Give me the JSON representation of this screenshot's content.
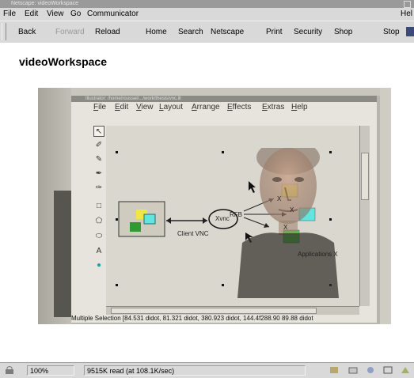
{
  "window": {
    "title": "Netscape: videoWorkspace"
  },
  "menu": [
    "File",
    "Edit",
    "View",
    "Go",
    "Communicator",
    "Hel"
  ],
  "toolbar": {
    "back": "Back",
    "forward": "Forward",
    "reload": "Reload",
    "home": "Home",
    "search": "Search",
    "netscape": "Netscape",
    "print": "Print",
    "security": "Security",
    "shop": "Shop",
    "stop": "Stop"
  },
  "page": {
    "heading": "videoWorkspace"
  },
  "illustrator": {
    "title": "Illustrator: /home/roussel/.../work/thesis/vnc.ill",
    "menu": [
      "File",
      "Edit",
      "View",
      "Layout",
      "Arrange",
      "Effects",
      "Extras",
      "Help"
    ],
    "status": "Multiple Selection [84.531 didot, 81.321 didot, 380.923 didot, 144.4f288.90 89.88 didot",
    "labels": {
      "client": "Client VNC",
      "rfb": "RFB",
      "xvnc": "Xvnc",
      "x1": "X",
      "x2": "X",
      "x3": "X",
      "apps": "Applications X"
    },
    "colors": {
      "yellow": "#f2e640",
      "cyan": "#5ee6e0",
      "green": "#4cd64c",
      "darkgreen": "#2f9a2f"
    },
    "tools": [
      "arrow-tool",
      "pen-tool",
      "pencil-tool",
      "brush-tool",
      "eraser-tool",
      "rectangle-tool",
      "polygon-tool",
      "ellipse-tool",
      "text-tool",
      "color-tool"
    ]
  },
  "statusbar": {
    "zoom": "100%",
    "progress": "9515K read (at 108.1K/sec)"
  }
}
